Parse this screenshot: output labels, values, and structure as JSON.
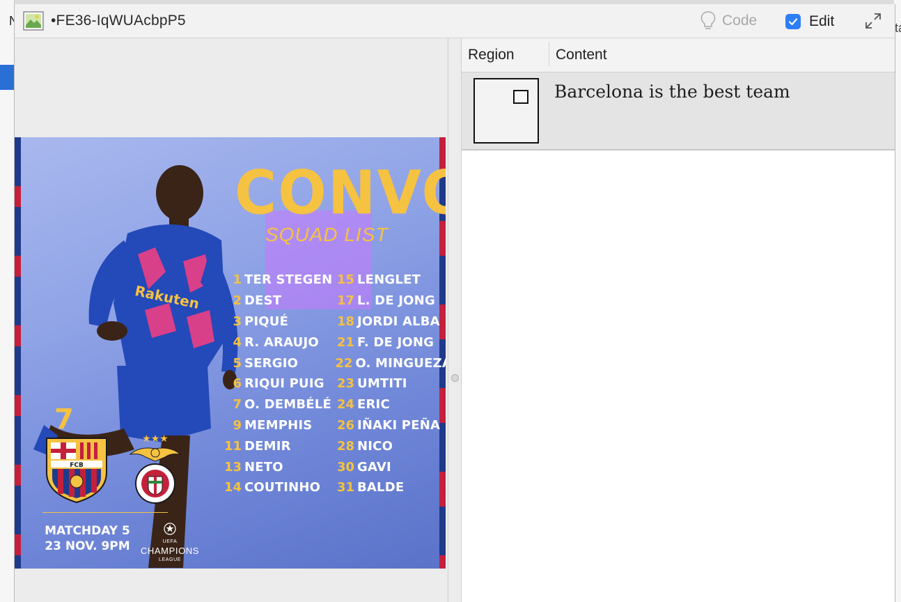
{
  "background_app": {
    "left_char": "N",
    "right_char": "ta"
  },
  "titlebar": {
    "file_title": "•FE36-IqWUAcbpP5",
    "code_label": "Code",
    "edit_label": "Edit",
    "edit_checked": true
  },
  "poster": {
    "headline": "CONVO",
    "subtitle": "SQUAD LIST",
    "squad_left": [
      {
        "num": "1",
        "name": "TER STEGEN"
      },
      {
        "num": "2",
        "name": "DEST"
      },
      {
        "num": "3",
        "name": "PIQUÉ"
      },
      {
        "num": "4",
        "name": "R. ARAUJO"
      },
      {
        "num": "5",
        "name": "SERGIO"
      },
      {
        "num": "6",
        "name": "RIQUI PUIG"
      },
      {
        "num": "7",
        "name": "O. DEMBÉLÉ"
      },
      {
        "num": "9",
        "name": "MEMPHIS"
      },
      {
        "num": "11",
        "name": "DEMIR"
      },
      {
        "num": "13",
        "name": "NETO"
      },
      {
        "num": "14",
        "name": "COUTINHO"
      }
    ],
    "squad_right": [
      {
        "num": "15",
        "name": "LENGLET"
      },
      {
        "num": "17",
        "name": "L. DE JONG"
      },
      {
        "num": "18",
        "name": "JORDI ALBA"
      },
      {
        "num": "21",
        "name": "F. DE JONG"
      },
      {
        "num": "22",
        "name": "O. MINGUEZA"
      },
      {
        "num": "23",
        "name": "UMTITI"
      },
      {
        "num": "24",
        "name": "ERIC"
      },
      {
        "num": "26",
        "name": "IÑAKI PEÑA"
      },
      {
        "num": "28",
        "name": "NICO"
      },
      {
        "num": "30",
        "name": "GAVI"
      },
      {
        "num": "31",
        "name": "BALDE"
      }
    ],
    "fcb_crest_text": "FCB",
    "sponsor_text": "Rakuten",
    "matchday_label": "MATCHDAY 5",
    "match_date": "23 NOV. 9PM",
    "competition_top": "UEFA",
    "competition_line1": "CHAMPIONS",
    "competition_line2": "LEAGUE",
    "colors": {
      "gold": "#f5c242",
      "barca_blue": "#1f3a8a",
      "barca_red": "#c4203c"
    }
  },
  "table": {
    "headers": {
      "region": "Region",
      "content": "Content"
    },
    "rows": [
      {
        "content": "Barcelona is the best team"
      }
    ]
  },
  "icons": [
    "image-file-icon",
    "lightbulb-icon",
    "checkbox-icon",
    "expand-icon"
  ]
}
